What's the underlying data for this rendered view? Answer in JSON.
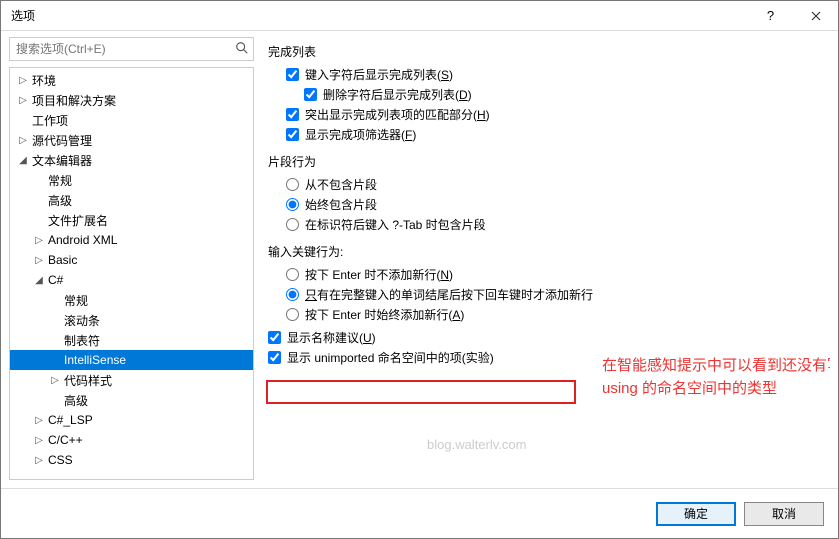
{
  "window": {
    "title": "选项",
    "help": "?",
    "close": "🗙"
  },
  "search": {
    "placeholder": "搜索选项(Ctrl+E)"
  },
  "tree": [
    {
      "label": "环境",
      "arrow": "▷",
      "indent": 0
    },
    {
      "label": "项目和解决方案",
      "arrow": "▷",
      "indent": 0
    },
    {
      "label": "工作项",
      "arrow": "",
      "indent": 0
    },
    {
      "label": "源代码管理",
      "arrow": "▷",
      "indent": 0
    },
    {
      "label": "文本编辑器",
      "arrow": "◢",
      "indent": 0
    },
    {
      "label": "常规",
      "arrow": "",
      "indent": 1
    },
    {
      "label": "高级",
      "arrow": "",
      "indent": 1
    },
    {
      "label": "文件扩展名",
      "arrow": "",
      "indent": 1
    },
    {
      "label": "Android XML",
      "arrow": "▷",
      "indent": 1
    },
    {
      "label": "Basic",
      "arrow": "▷",
      "indent": 1
    },
    {
      "label": "C#",
      "arrow": "◢",
      "indent": 1
    },
    {
      "label": "常规",
      "arrow": "",
      "indent": 2
    },
    {
      "label": "滚动条",
      "arrow": "",
      "indent": 2
    },
    {
      "label": "制表符",
      "arrow": "",
      "indent": 2
    },
    {
      "label": "IntelliSense",
      "arrow": "",
      "indent": 2,
      "selected": true
    },
    {
      "label": "代码样式",
      "arrow": "▷",
      "indent": 2
    },
    {
      "label": "高级",
      "arrow": "",
      "indent": 2
    },
    {
      "label": "C#_LSP",
      "arrow": "▷",
      "indent": 1
    },
    {
      "label": "C/C++",
      "arrow": "▷",
      "indent": 1
    },
    {
      "label": "CSS",
      "arrow": "▷",
      "indent": 1
    }
  ],
  "panel": {
    "group1": "完成列表",
    "opt1": {
      "text": "键入字符后显示完成列表(",
      "accel": "S",
      "suffix": ")"
    },
    "opt2": {
      "text": "删除字符后显示完成列表(",
      "accel": "D",
      "suffix": ")"
    },
    "opt3": {
      "text": "突出显示完成列表项的匹配部分(",
      "accel": "H",
      "suffix": ")"
    },
    "opt4": {
      "text": "显示完成项筛选器(",
      "accel": "F",
      "suffix": ")"
    },
    "group2": "片段行为",
    "r1": "从不包含片段",
    "r2": "始终包含片段",
    "r3": "在标识符后键入 ?-Tab 时包含片段",
    "group3": "输入关键行为:",
    "r4": {
      "text": "按下 Enter 时不添加新行(",
      "accel": "N",
      "suffix": ")"
    },
    "r5": {
      "pre": "只",
      "text": "有在完整键入的单词结尾后按下回车键时才添加新行"
    },
    "r6": {
      "text": "按下 Enter 时始终添加新行(",
      "accel": "A",
      "suffix": ")"
    },
    "opt5": {
      "text": "显示名称建议(",
      "accel": "U",
      "suffix": ")"
    },
    "opt6": "显示 unimported 命名空间中的项(实验)",
    "annotation": "在智能感知提示中可以看到还没有写 using 的命名空间中的类型",
    "watermark": "blog.walterlv.com"
  },
  "footer": {
    "ok": "确定",
    "cancel": "取消"
  }
}
